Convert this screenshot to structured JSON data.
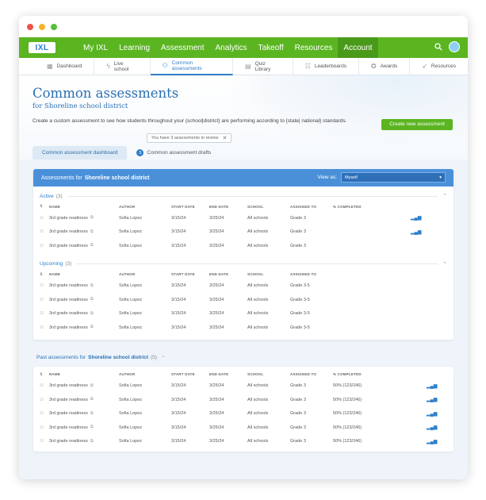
{
  "window_controls": {
    "close": "#f0504a",
    "minimize": "#f5b52f",
    "maximize": "#55c038"
  },
  "logo": {
    "text": "IXL"
  },
  "nav": {
    "items": [
      "My IXL",
      "Learning",
      "Assessment",
      "Analytics",
      "Takeoff",
      "Resources",
      "Account"
    ],
    "active": "Account"
  },
  "subnav": {
    "items": [
      "Dashboard",
      "Live school",
      "Common assessments",
      "Quiz Library",
      "Leaderboards",
      "Awards",
      "Resources"
    ],
    "active": "Common assessments"
  },
  "header": {
    "title": "Common assessments",
    "subtitle": "for Shoreline school district",
    "description": "Create a custom assessment to see how students throughout your {school|district} are performing according to {state| national} standards.",
    "create_button": "Create new assessment",
    "review_notice": "You have 3 assessments to review"
  },
  "tabs": {
    "dashboard": "Common assessment dashboard",
    "drafts": "Common assessment drafts",
    "drafts_count": "3"
  },
  "card": {
    "title_prefix": "Assessments for",
    "title_bold": "Shoreline school district",
    "view_as_label": "View as:",
    "view_as_value": "Myself"
  },
  "columns": {
    "name": "NAME",
    "author": "AUTHOR",
    "start": "START DATE",
    "end": "END DATE",
    "school": "SCHOOL",
    "assigned": "ASSIGNED TO",
    "completed": "% COMPLETED"
  },
  "active": {
    "label": "Active",
    "count": "(3)",
    "rows": [
      {
        "name": "3rd grade readiness",
        "author": "Sofia Lopez",
        "start": "3/15/24",
        "end": "3/25/24",
        "school": "All schools",
        "assigned": "Grade 3",
        "progress": 0.45,
        "striped": 0.28
      },
      {
        "name": "3rd grade readiness",
        "author": "Sofia Lopez",
        "start": "3/15/24",
        "end": "3/25/24",
        "school": "All schools",
        "assigned": "Grade 3",
        "progress": 0.15,
        "striped": 0.3
      },
      {
        "name": "3rd grade readiness",
        "author": "Sofia Lopez",
        "start": "3/15/24",
        "end": "3/25/24",
        "school": "All schools",
        "assigned": "Grade 3",
        "progress": 0,
        "striped": 0
      }
    ]
  },
  "upcoming": {
    "label": "Upcoming",
    "count": "(3)",
    "rows": [
      {
        "name": "3rd grade readiness",
        "author": "Sofia Lopez",
        "start": "3/15/24",
        "end": "3/25/24",
        "school": "All schools",
        "assigned": "Grade 3-5"
      },
      {
        "name": "3rd grade readiness",
        "author": "Sofia Lopez",
        "start": "3/15/24",
        "end": "3/25/24",
        "school": "All schools",
        "assigned": "Grade 3-5"
      },
      {
        "name": "3rd grade readiness",
        "author": "Sofia Lopez",
        "start": "3/15/24",
        "end": "3/25/24",
        "school": "All schools",
        "assigned": "Grade 3-5"
      },
      {
        "name": "3rd grade readiness",
        "author": "Sofia Lopez",
        "start": "3/15/24",
        "end": "3/25/24",
        "school": "All schools",
        "assigned": "Grade 3-5"
      }
    ]
  },
  "past": {
    "title_prefix": "Past assessments for",
    "title_bold": "Shoreline school district",
    "count": "(5)",
    "rows": [
      {
        "name": "3rd grade readiness",
        "author": "Sofia Lopez",
        "start": "3/15/24",
        "end": "3/25/24",
        "school": "All schools",
        "assigned": "Grade 3",
        "completed": "50%  (123/246)"
      },
      {
        "name": "3rd grade readiness",
        "author": "Sofia Lopez",
        "start": "3/15/24",
        "end": "3/25/24",
        "school": "All schools",
        "assigned": "Grade 3",
        "completed": "50%  (123/246)"
      },
      {
        "name": "3rd grade readiness",
        "author": "Sofia Lopez",
        "start": "3/15/24",
        "end": "3/25/24",
        "school": "All schools",
        "assigned": "Grade 3",
        "completed": "50%  (123/246)"
      },
      {
        "name": "3rd grade readiness",
        "author": "Sofia Lopez",
        "start": "3/15/24",
        "end": "3/25/24",
        "school": "All schools",
        "assigned": "Grade 3",
        "completed": "50%  (123/246)"
      },
      {
        "name": "3rd grade readiness",
        "author": "Sofia Lopez",
        "start": "3/15/24",
        "end": "3/25/24",
        "school": "All schools",
        "assigned": "Grade 3",
        "completed": "50%  (123/246)"
      }
    ]
  }
}
